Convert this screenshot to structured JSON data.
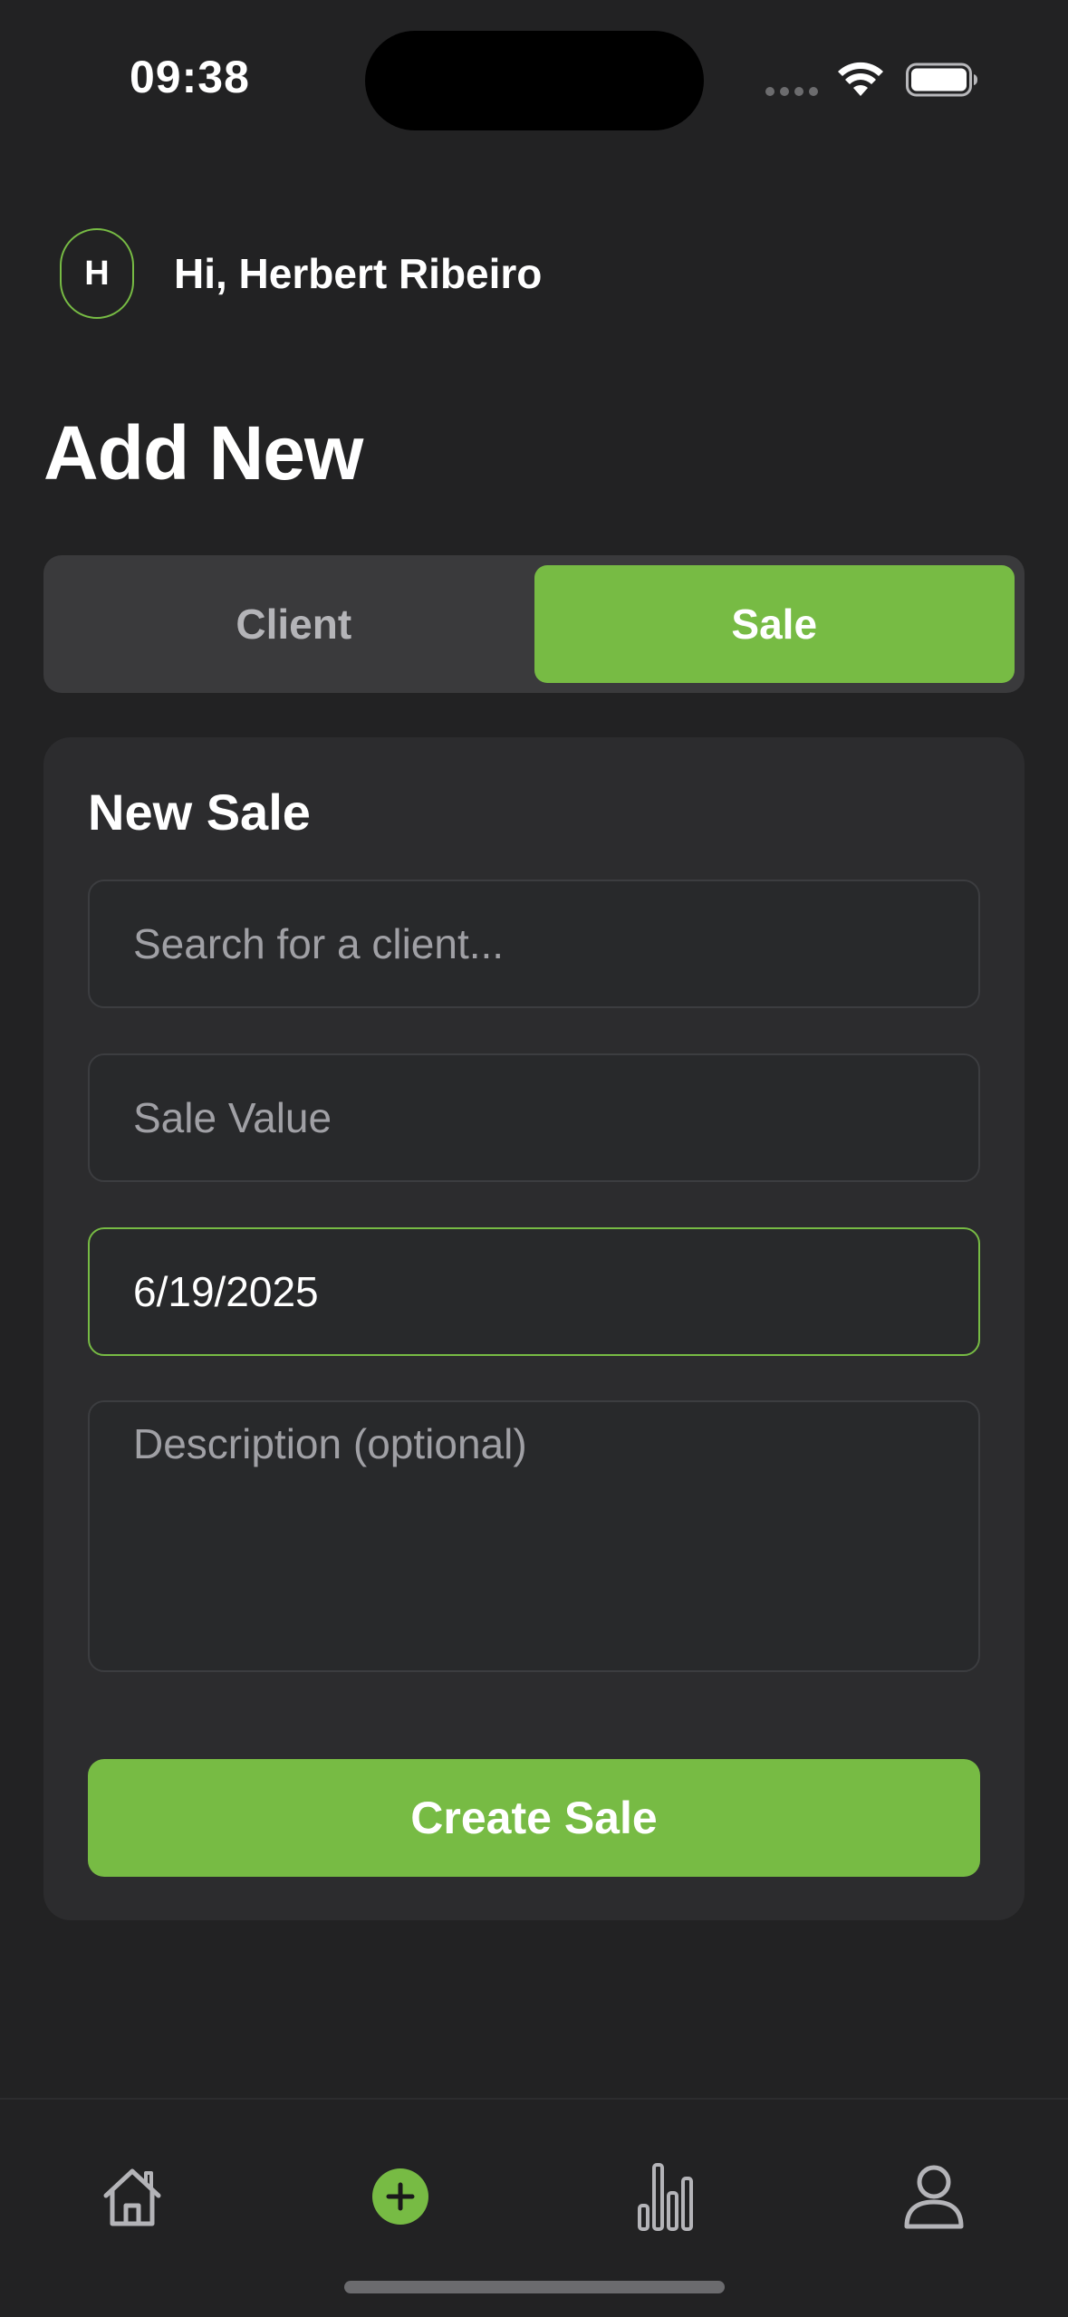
{
  "status_bar": {
    "time": "09:38"
  },
  "header": {
    "avatar_initial": "H",
    "greeting": "Hi, Herbert Ribeiro"
  },
  "page": {
    "title": "Add New"
  },
  "segmented_control": {
    "options": [
      {
        "label": "Client",
        "selected": false
      },
      {
        "label": "Sale",
        "selected": true
      }
    ]
  },
  "form": {
    "title": "New Sale",
    "client_search": {
      "placeholder": "Search for a client...",
      "value": ""
    },
    "sale_value": {
      "placeholder": "Sale Value",
      "value": ""
    },
    "date": {
      "value": "6/19/2025"
    },
    "description": {
      "placeholder": "Description (optional)",
      "value": ""
    },
    "submit_label": "Create Sale"
  },
  "tab_bar": {
    "items": [
      {
        "icon": "home-icon",
        "active": false
      },
      {
        "icon": "add-circle-icon",
        "active": true
      },
      {
        "icon": "bar-chart-icon",
        "active": false
      },
      {
        "icon": "user-icon",
        "active": false
      }
    ]
  },
  "colors": {
    "accent": "#77bb44",
    "background": "#222223",
    "card": "#2c2c2e",
    "segmented_bg": "#3a3a3c",
    "inactive_icon": "#b4b4b8"
  }
}
